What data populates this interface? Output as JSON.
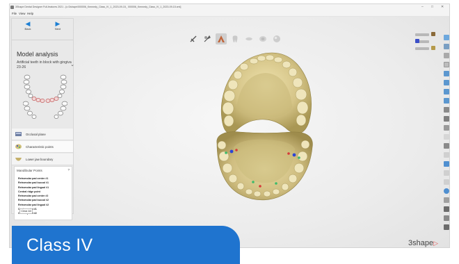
{
  "window": {
    "title": "3Shape Dental Designer Full-features 2021 - [c:\\3shape\\000006_Kennedy_Class_IV_1_2023-09-15_ 000006_Kennedy_Class_IV_1_2023-09-15.xml]"
  },
  "menu": [
    "File",
    "View",
    "Help"
  ],
  "nav": {
    "back": "Back",
    "next": "Next"
  },
  "panel": {
    "title": "Model analysis",
    "selection": "Artificial teeth in block with gingiva 23-26",
    "steps": [
      "Occlusal plane",
      "Characteristic points",
      "Lower jaw boundary"
    ]
  },
  "mandibular": {
    "header": "Mandibular Points",
    "help": "?",
    "points": [
      "Retromolar pad center #1",
      "Retromolar pad buccal #1",
      "Retromolar pad lingual #1",
      "Central ridge point",
      "Retromolar pad center #2",
      "Retromolar pad buccal #2",
      "Retromolar pad lingual #2",
      "Canine point #1",
      "Canine point #2"
    ],
    "clear": "Clear All"
  },
  "banner": {
    "text": "Class IV",
    "color": "#1f74cf"
  },
  "logo": {
    "text": "3shape",
    "mark": "▷"
  },
  "colors": {
    "accent": "#1c7fd4",
    "model": "#d6c78f",
    "points_blue": "#2b45d6",
    "points_green": "#3dbb6a",
    "points_red": "#d63a3a"
  },
  "toolbar_icons": [
    "cut-tool-icon",
    "brush-tool-icon",
    "upper-jaw-icon",
    "tooth-icon",
    "gingiva-icon",
    "occlusal-icon",
    "sphere-icon"
  ]
}
